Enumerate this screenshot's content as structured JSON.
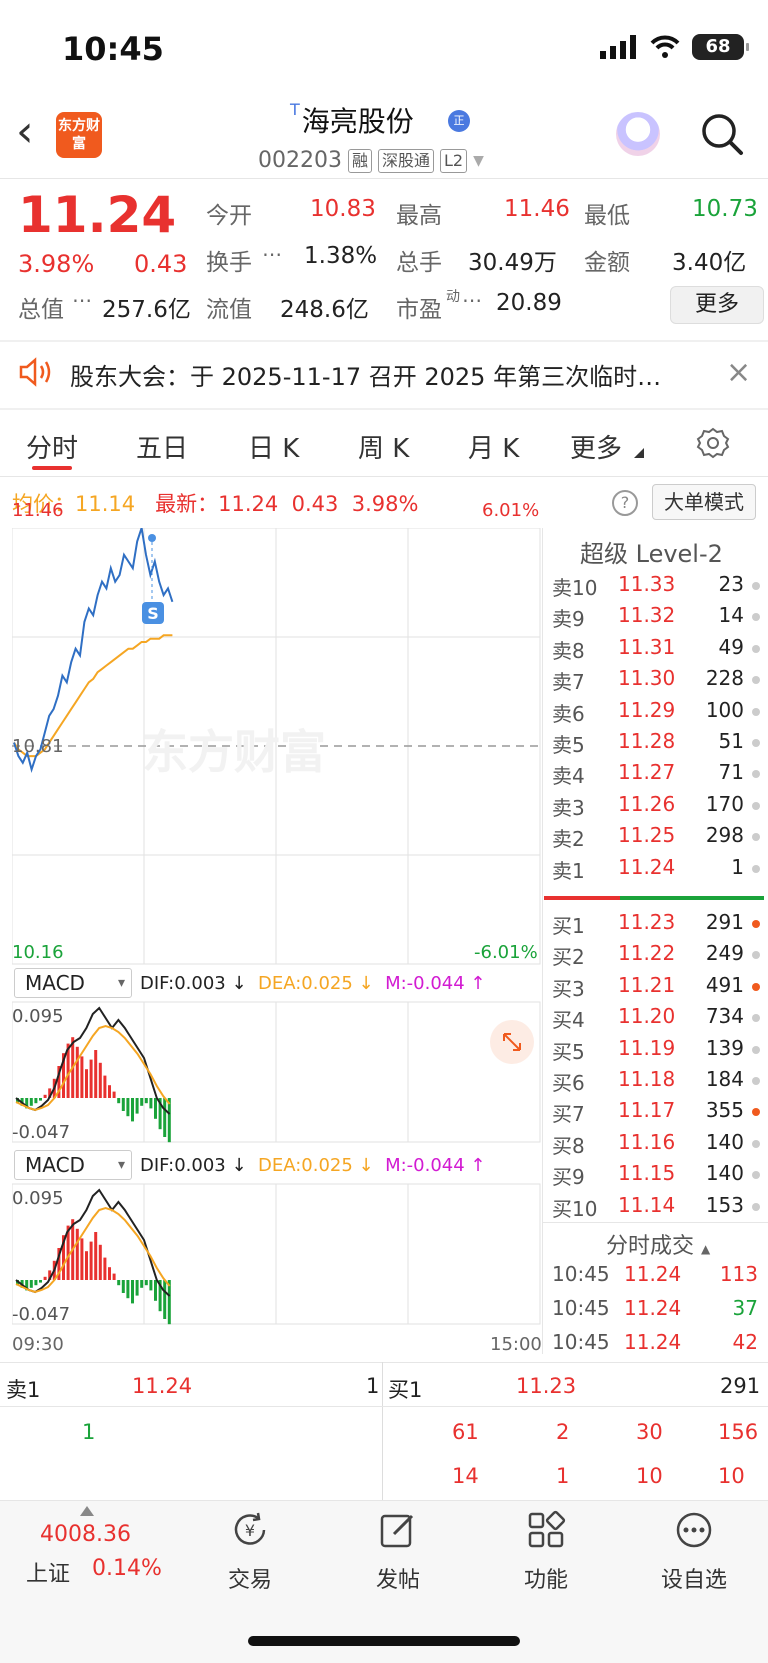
{
  "status_bar": {
    "time": "10:45",
    "battery": "68"
  },
  "header": {
    "logo_text": "东方财富",
    "stock_name": "海亮股份",
    "stock_prefix": "T",
    "verify_icon": "正",
    "stock_code": "002203",
    "tags": [
      "融",
      "深股通",
      "L2"
    ]
  },
  "quote": {
    "price": "11.24",
    "change_pct": "3.98%",
    "change": "0.43",
    "open_label": "今开",
    "open": "10.83",
    "high_label": "最高",
    "high": "11.46",
    "low_label": "最低",
    "low": "10.73",
    "turnover_label": "换手",
    "turnover": "1.38%",
    "volume_label": "总手",
    "volume": "30.49万",
    "amount_label": "金额",
    "amount": "3.40亿",
    "mcap_label": "总值",
    "mcap": "257.6亿",
    "float_label": "流值",
    "float": "248.6亿",
    "pe_label": "市盈",
    "pe_sup": "动",
    "pe": "20.89",
    "more": "更多"
  },
  "notice": {
    "text": "股东大会：于 2025-11-17 召开 2025 年第三次临时…",
    "close": "×"
  },
  "tabs": [
    "分时",
    "五日",
    "日 K",
    "周 K",
    "月 K",
    "更多"
  ],
  "info_line": {
    "avg_label": "均价：",
    "avg": "11.14",
    "latest_label": "最新：",
    "latest": "11.24",
    "chg": "0.43",
    "pct": "3.98%",
    "help": "?",
    "big_order": "大单模式"
  },
  "chart_labels": {
    "top_price": "11.46",
    "top_pct": "6.01%",
    "mid_price": "10.81",
    "bottom_price": "10.16",
    "bottom_pct": "-6.01%",
    "watermark": "东方财富",
    "signal": "S",
    "time_start": "09:30",
    "time_end": "15:00"
  },
  "macd1": {
    "selector": "MACD",
    "dif": "DIF:0.003 ↓",
    "dea": "DEA:0.025 ↓",
    "m": "M:-0.044 ↑",
    "max": "0.095",
    "min": "-0.047"
  },
  "macd2": {
    "selector": "MACD",
    "dif": "DIF:0.003 ↓",
    "dea": "DEA:0.025 ↓",
    "m": "M:-0.044 ↑",
    "max": "0.095",
    "min": "-0.047"
  },
  "chart_data": {
    "type": "line",
    "y_range": [
      10.16,
      11.46
    ],
    "pre_close": 10.81,
    "series": [
      {
        "values": [
          10.82,
          10.78,
          10.76,
          10.79,
          10.74,
          10.78,
          10.8,
          10.85,
          10.9,
          10.92,
          10.96,
          11.02,
          11.0,
          11.06,
          11.1,
          11.08,
          11.18,
          11.22,
          11.2,
          11.26,
          11.3,
          11.28,
          11.34,
          11.3,
          11.32,
          11.38,
          11.36,
          11.34,
          11.42,
          11.46,
          11.38,
          11.32,
          11.36,
          11.3,
          11.26,
          11.28,
          11.24
        ]
      },
      {
        "values": [
          10.82,
          10.8,
          10.79,
          10.78,
          10.78,
          10.78,
          10.79,
          10.8,
          10.82,
          10.84,
          10.86,
          10.88,
          10.9,
          10.92,
          10.94,
          10.96,
          10.98,
          11.0,
          11.01,
          11.03,
          11.04,
          11.05,
          11.06,
          11.07,
          11.08,
          11.09,
          11.1,
          11.1,
          11.11,
          11.12,
          11.12,
          11.13,
          11.13,
          11.13,
          11.14,
          11.14,
          11.14
        ]
      }
    ]
  },
  "level2": {
    "title": "超级 Level-2",
    "asks": [
      {
        "label": "卖10",
        "price": "11.33",
        "vol": "23",
        "dot": false
      },
      {
        "label": "卖9",
        "price": "11.32",
        "vol": "14",
        "dot": false
      },
      {
        "label": "卖8",
        "price": "11.31",
        "vol": "49",
        "dot": false
      },
      {
        "label": "卖7",
        "price": "11.30",
        "vol": "228",
        "dot": false
      },
      {
        "label": "卖6",
        "price": "11.29",
        "vol": "100",
        "dot": false
      },
      {
        "label": "卖5",
        "price": "11.28",
        "vol": "51",
        "dot": false
      },
      {
        "label": "卖4",
        "price": "11.27",
        "vol": "71",
        "dot": false
      },
      {
        "label": "卖3",
        "price": "11.26",
        "vol": "170",
        "dot": false
      },
      {
        "label": "卖2",
        "price": "11.25",
        "vol": "298",
        "dot": false
      },
      {
        "label": "卖1",
        "price": "11.24",
        "vol": "1",
        "dot": false
      }
    ],
    "bids": [
      {
        "label": "买1",
        "price": "11.23",
        "vol": "291",
        "dot": true
      },
      {
        "label": "买2",
        "price": "11.22",
        "vol": "249",
        "dot": false
      },
      {
        "label": "买3",
        "price": "11.21",
        "vol": "491",
        "dot": true
      },
      {
        "label": "买4",
        "price": "11.20",
        "vol": "734",
        "dot": false
      },
      {
        "label": "买5",
        "price": "11.19",
        "vol": "139",
        "dot": false
      },
      {
        "label": "买6",
        "price": "11.18",
        "vol": "184",
        "dot": false
      },
      {
        "label": "买7",
        "price": "11.17",
        "vol": "355",
        "dot": true
      },
      {
        "label": "买8",
        "price": "11.16",
        "vol": "140",
        "dot": false
      },
      {
        "label": "买9",
        "price": "11.15",
        "vol": "140",
        "dot": false
      },
      {
        "label": "买10",
        "price": "11.14",
        "vol": "153",
        "dot": false
      }
    ],
    "ticks_title": "分时成交",
    "ticks": [
      {
        "time": "10:45",
        "price": "11.24",
        "vol": "113",
        "color": "#e8312f"
      },
      {
        "time": "10:45",
        "price": "11.24",
        "vol": "37",
        "color": "#1aa33a"
      },
      {
        "time": "10:45",
        "price": "11.24",
        "vol": "42",
        "color": "#e8312f"
      }
    ]
  },
  "queue": {
    "sell_label": "卖1",
    "sell_price": "11.24",
    "sell_vol": "1",
    "buy_label": "买1",
    "buy_price": "11.23",
    "buy_vol": "291",
    "sell_items": [
      "1"
    ],
    "buy_items_row1": [
      "61",
      "2",
      "30",
      "156"
    ],
    "buy_items_row2": [
      "14",
      "1",
      "10",
      "10"
    ]
  },
  "bottom_nav": {
    "index_value": "4008.36",
    "index_name": "上证",
    "index_pct": "0.14%",
    "items": [
      "交易",
      "发帖",
      "功能",
      "设自选"
    ]
  },
  "colors": {
    "up": "#e8312f",
    "down": "#1aa33a",
    "avg": "#f5a623",
    "price_line": "#2f6fc4",
    "accent": "#e8312f"
  }
}
